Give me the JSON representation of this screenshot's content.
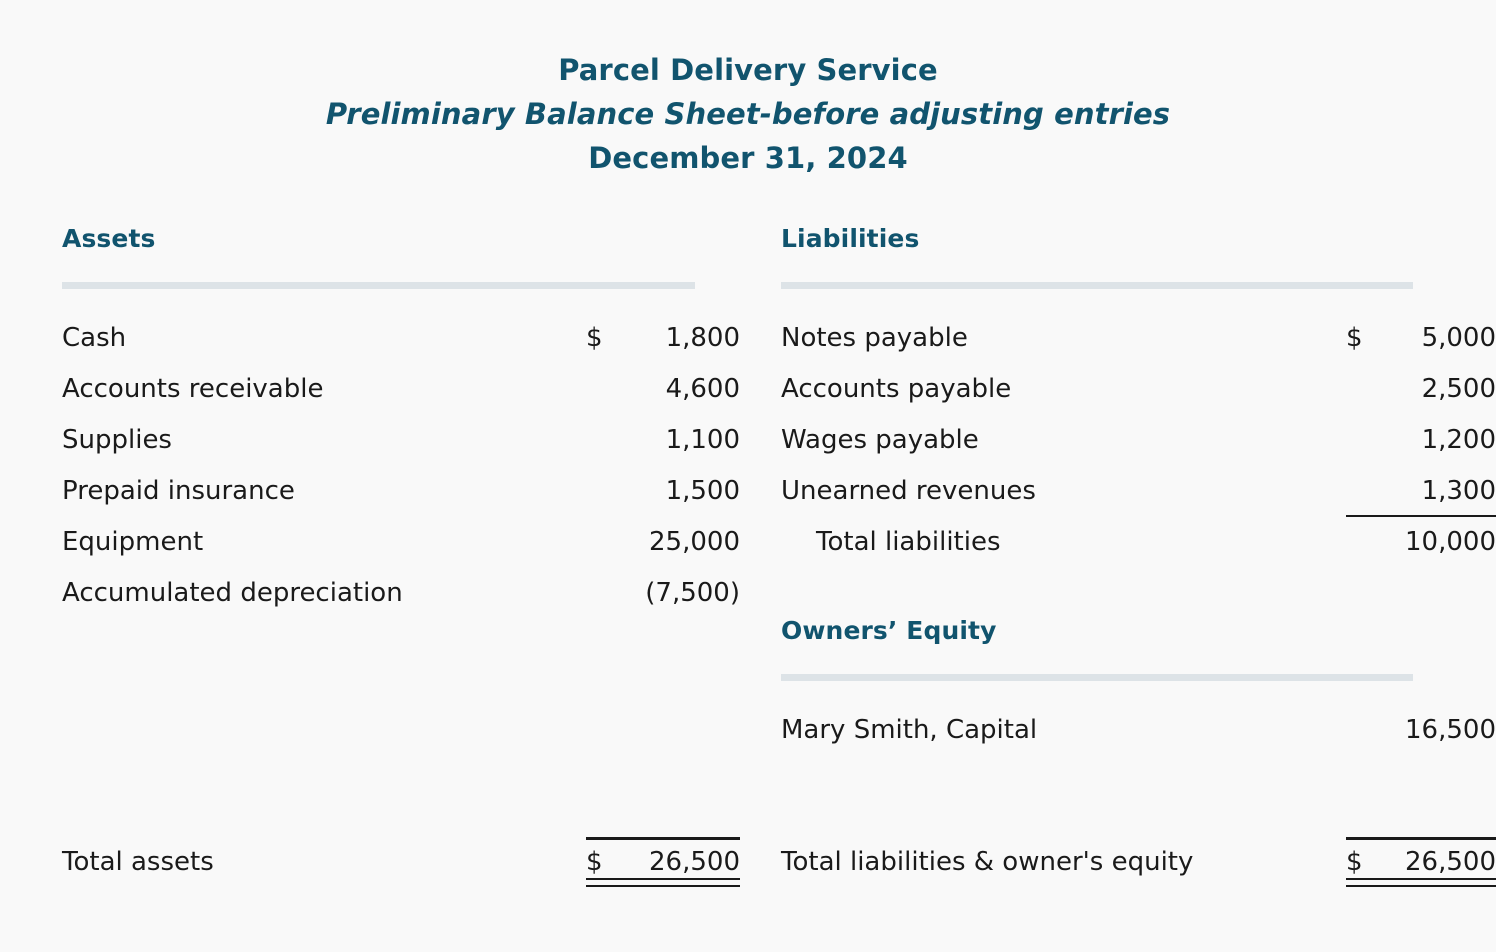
{
  "document": {
    "company": "Parcel Delivery Service",
    "statement": "Preliminary Balance Sheet-before adjusting entries",
    "date": "December 31, 2024",
    "accent_color": "#11546e",
    "rule_color": "#dde3e7",
    "background": "#f9f9f9",
    "text_color": "#1a1a1a"
  },
  "assets": {
    "heading": "Assets",
    "items": [
      {
        "label": "Cash",
        "currency": "$",
        "amount": "1,800"
      },
      {
        "label": "Accounts receivable",
        "currency": "",
        "amount": "4,600"
      },
      {
        "label": "Supplies",
        "currency": "",
        "amount": "1,100"
      },
      {
        "label": "Prepaid insurance",
        "currency": "",
        "amount": "1,500"
      },
      {
        "label": "Equipment",
        "currency": "",
        "amount": "25,000"
      },
      {
        "label": "Accumulated depreciation",
        "currency": "",
        "amount": "(7,500)"
      }
    ],
    "total": {
      "label": "Total assets",
      "currency": "$",
      "amount": "26,500"
    }
  },
  "liabilities": {
    "heading": "Liabilities",
    "items": [
      {
        "label": "Notes payable",
        "currency": "$",
        "amount": "5,000"
      },
      {
        "label": "Accounts payable",
        "currency": "",
        "amount": "2,500"
      },
      {
        "label": "Wages payable",
        "currency": "",
        "amount": "1,200"
      },
      {
        "label": "Unearned revenues",
        "currency": "",
        "amount": "1,300"
      }
    ],
    "subtotal": {
      "label": "Total liabilities",
      "currency": "",
      "amount": "10,000"
    }
  },
  "equity": {
    "heading": "Owners’ Equity",
    "items": [
      {
        "label": "Mary Smith, Capital",
        "currency": "",
        "amount": "16,500"
      }
    ]
  },
  "grand_total": {
    "label": "Total liabilities & owner's equity",
    "currency": "$",
    "amount": "26,500"
  }
}
